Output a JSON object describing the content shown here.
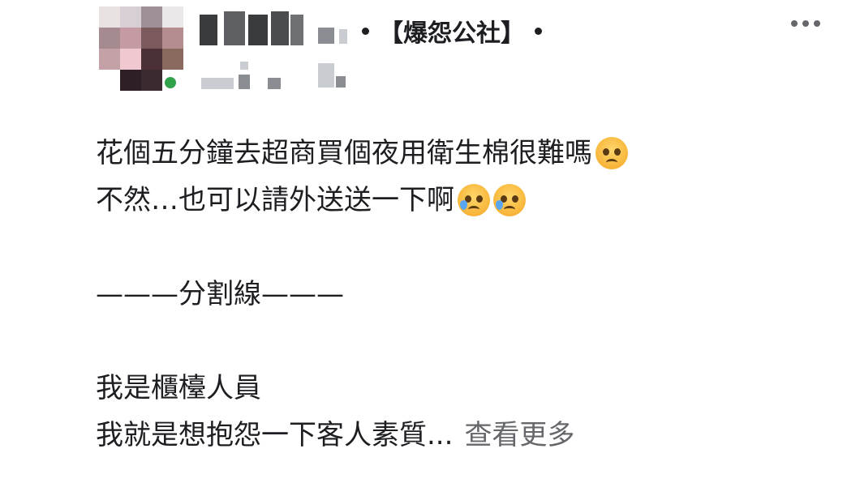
{
  "post": {
    "group_name": "【爆怨公社】",
    "more_icon": "more-horizontal-icon",
    "lines": [
      "花個五分鐘去超商買個夜用衛生棉很難嗎",
      "不然…也可以請外送送一下啊",
      "———分割線———",
      "我是櫃檯人員",
      "我就是想抱怨一下客人素質..."
    ],
    "see_more": "查看更多",
    "emoji_1": "pleading-face-emoji",
    "emoji_2": "sad-but-relieved-face-emoji",
    "colors": {
      "text": "#1c1e21",
      "secondary": "#65676b",
      "online": "#31a24c"
    }
  }
}
